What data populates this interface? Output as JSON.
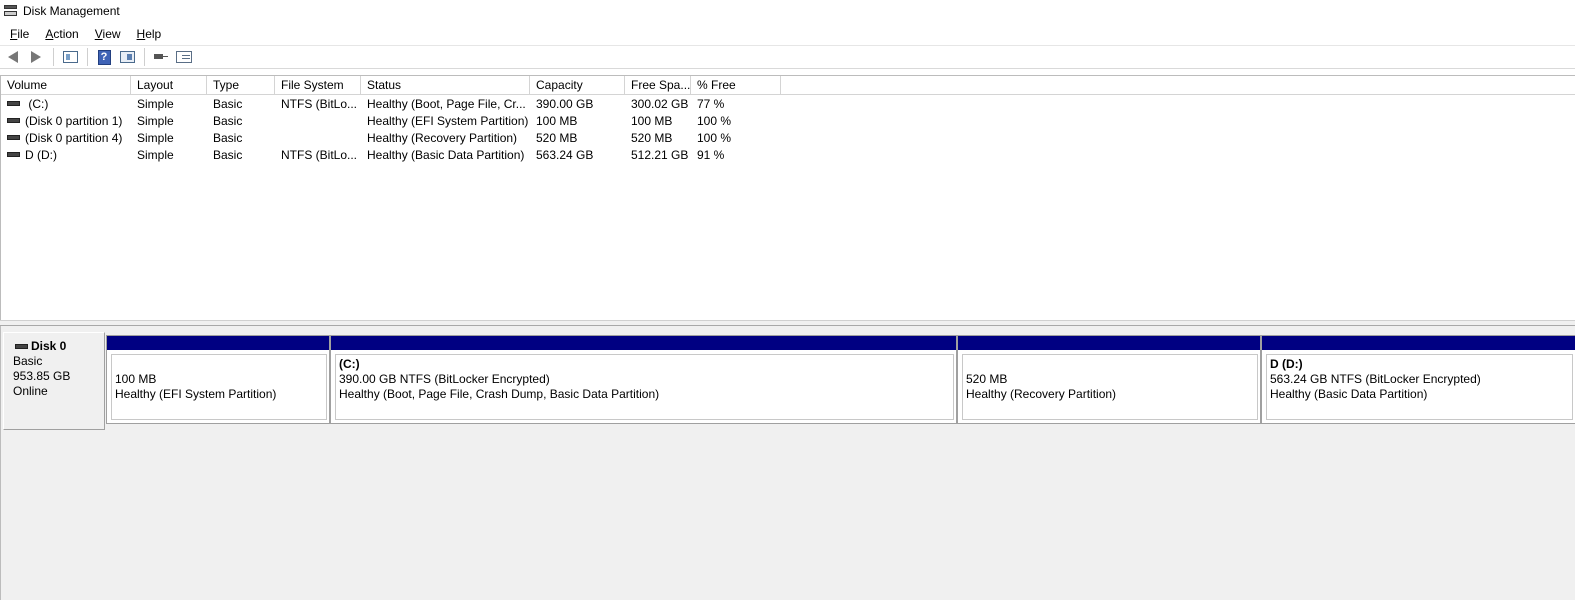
{
  "window": {
    "title": "Disk Management"
  },
  "menu": [
    {
      "label": "File",
      "accel": "F",
      "rest": "ile"
    },
    {
      "label": "Action",
      "accel": "A",
      "rest": "ction"
    },
    {
      "label": "View",
      "accel": "V",
      "rest": "iew"
    },
    {
      "label": "Help",
      "accel": "H",
      "rest": "elp"
    }
  ],
  "toolbar": {
    "icons": [
      "back-arrow-icon",
      "forward-arrow-icon",
      "show-hide-console-tree-icon",
      "help-icon",
      "properties-icon",
      "connect-disk-icon",
      "list-view-icon"
    ]
  },
  "volume_list": {
    "columns": [
      "Volume",
      "Layout",
      "Type",
      "File System",
      "Status",
      "Capacity",
      "Free Spa...",
      "% Free"
    ],
    "rows": [
      {
        "volume": " (C:)",
        "layout": "Simple",
        "type": "Basic",
        "fs": "NTFS (BitLo...",
        "status": "Healthy (Boot, Page File, Cr...",
        "capacity": "390.00 GB",
        "free": "300.02 GB",
        "pct": "77 %"
      },
      {
        "volume": "(Disk 0 partition 1)",
        "layout": "Simple",
        "type": "Basic",
        "fs": "",
        "status": "Healthy (EFI System Partition)",
        "capacity": "100 MB",
        "free": "100 MB",
        "pct": "100 %"
      },
      {
        "volume": "(Disk 0 partition 4)",
        "layout": "Simple",
        "type": "Basic",
        "fs": "",
        "status": "Healthy (Recovery Partition)",
        "capacity": "520 MB",
        "free": "520 MB",
        "pct": "100 %"
      },
      {
        "volume": "D (D:)",
        "layout": "Simple",
        "type": "Basic",
        "fs": "NTFS (BitLo...",
        "status": "Healthy (Basic Data Partition)",
        "capacity": "563.24 GB",
        "free": "512.21 GB",
        "pct": "91 %"
      }
    ]
  },
  "disk_view": {
    "disk": {
      "name": "Disk 0",
      "type": "Basic",
      "size": "953.85 GB",
      "state": "Online"
    },
    "partitions": [
      {
        "name": "",
        "detail": "100 MB",
        "status": "Healthy (EFI System Partition)"
      },
      {
        "name": "(C:)",
        "detail": "390.00 GB NTFS (BitLocker Encrypted)",
        "status": "Healthy (Boot, Page File, Crash Dump, Basic Data Partition)"
      },
      {
        "name": "",
        "detail": "520 MB",
        "status": "Healthy (Recovery Partition)"
      },
      {
        "name": "D  (D:)",
        "detail": "563.24 GB NTFS (BitLocker Encrypted)",
        "status": "Healthy (Basic Data Partition)"
      }
    ],
    "colors": {
      "primary_partition_bar": "#000082"
    }
  }
}
